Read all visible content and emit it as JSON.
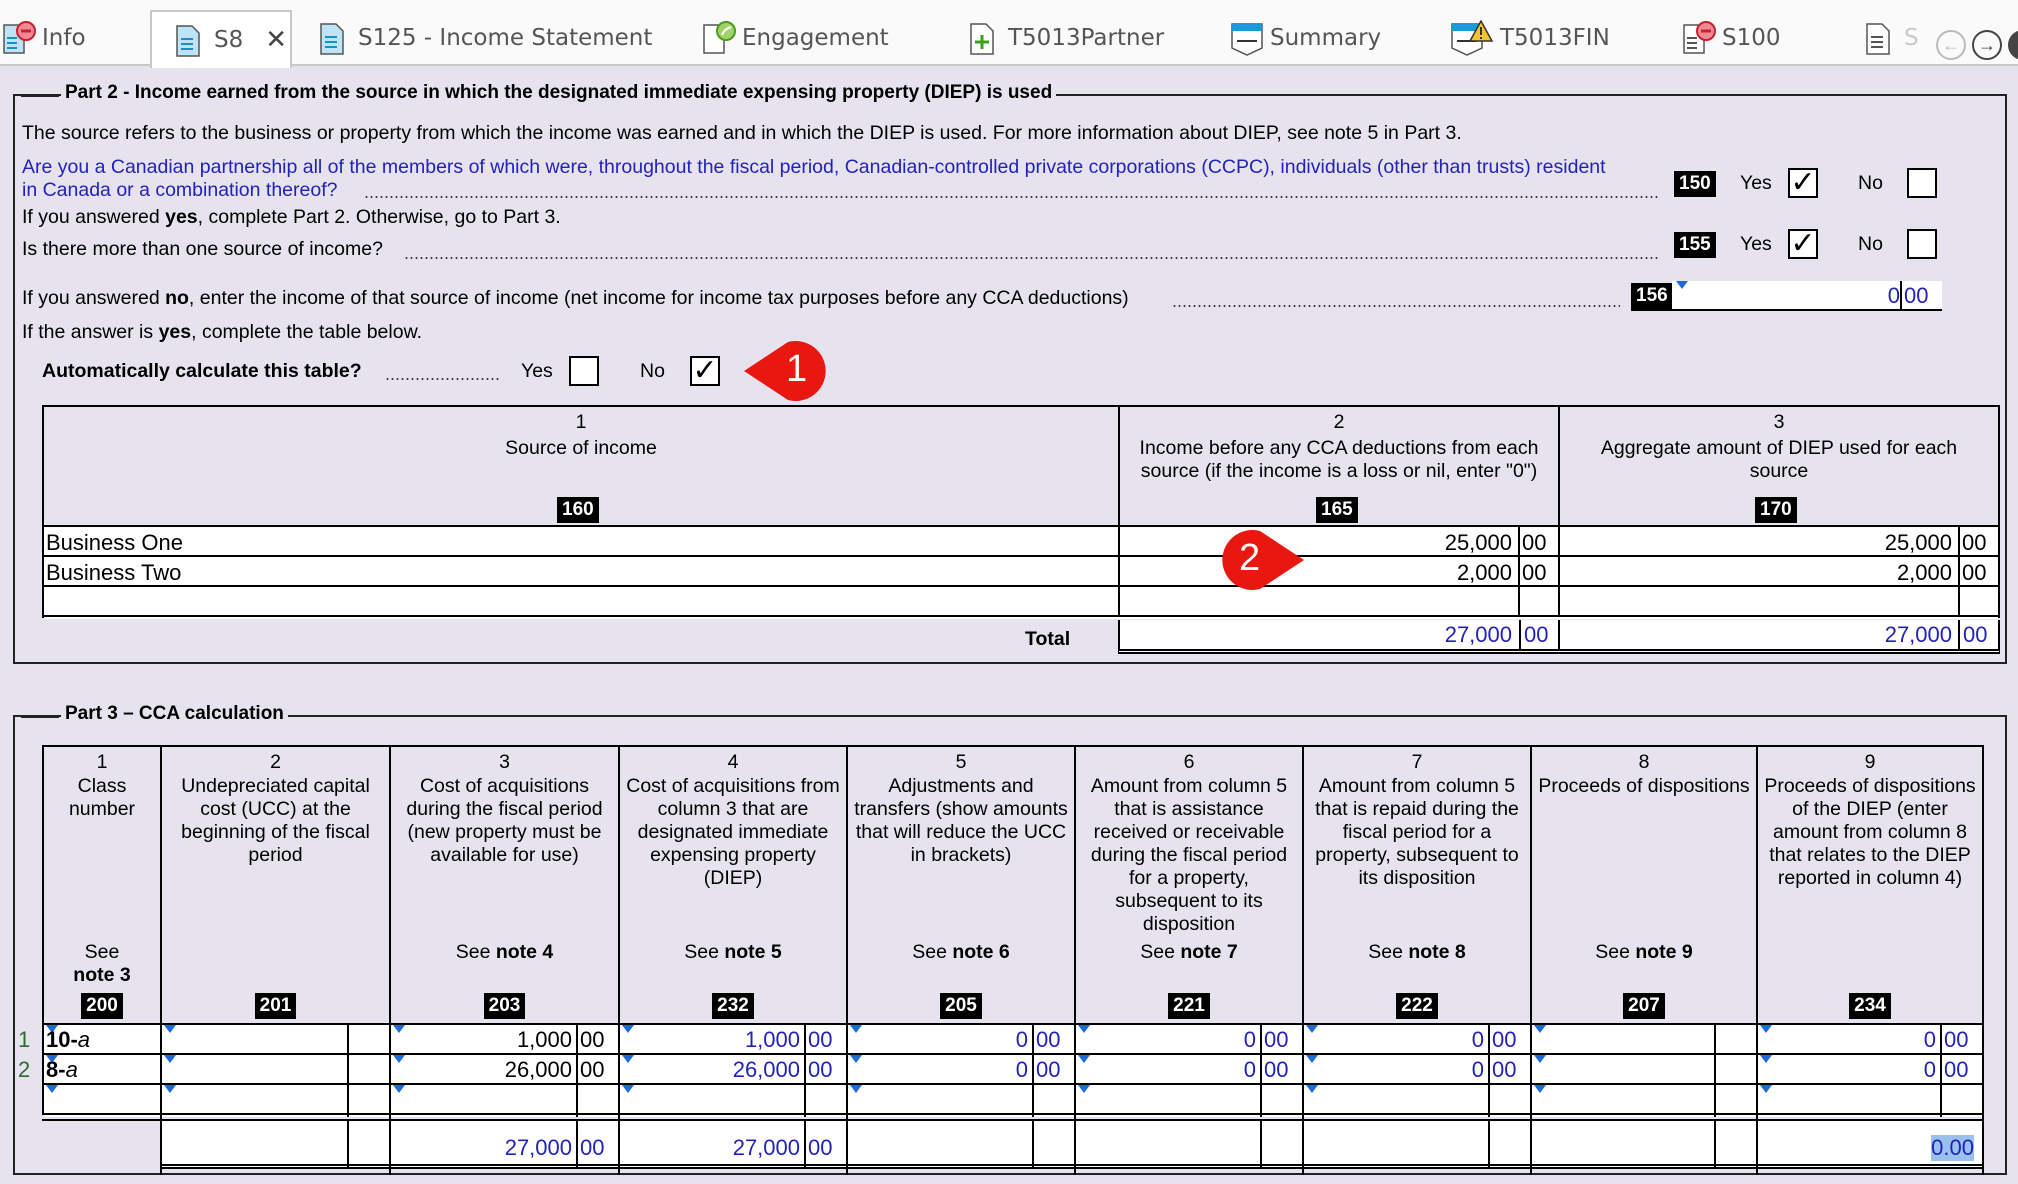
{
  "tabs": [
    {
      "label": "Info",
      "icon": "document-error-icon",
      "active": false
    },
    {
      "label": "S8",
      "icon": "document-icon",
      "active": true,
      "closable": true
    },
    {
      "label": "S125 - Income Statement",
      "icon": "document-icon",
      "active": false
    },
    {
      "label": "Engagement",
      "icon": "document-engagement-icon",
      "active": false
    },
    {
      "label": "T5013Partner",
      "icon": "document-add-icon",
      "active": false
    },
    {
      "label": "Summary",
      "icon": "summary-icon",
      "active": false
    },
    {
      "label": "T5013FIN",
      "icon": "summary-warning-icon",
      "active": false
    },
    {
      "label": "S100",
      "icon": "document-error-icon",
      "active": false
    },
    {
      "label": "S",
      "icon": "document-icon",
      "active": false
    }
  ],
  "part2": {
    "title": "Part 2 - Income earned from the source in which the designated immediate expensing property (DIEP) is used",
    "intro": "The source refers to the business or property from which the income was earned and in which the DIEP is used. For more information about DIEP, see note 5 in Part 3.",
    "q150": {
      "line1": "Are you a Canadian partnership all of the members of which were, throughout the fiscal period, Canadian-controlled private corporations (CCPC), individuals (other than trusts) resident",
      "line2": "in Canada or a combination thereof?",
      "code": "150",
      "yes_label": "Yes",
      "no_label": "No",
      "yes_checked": true,
      "no_checked": false
    },
    "after150_pre": "If you answered ",
    "after150_bold": "yes",
    "after150_post": ", complete Part 2. Otherwise, go to Part 3.",
    "q155": {
      "text": "Is there more than one source of income?",
      "code": "155",
      "yes_label": "Yes",
      "no_label": "No",
      "yes_checked": true,
      "no_checked": false
    },
    "q156": {
      "pre": "If you answered ",
      "bold": "no",
      "post": ", enter the income of that source of income (net income for income tax purposes before any CCA deductions)",
      "code": "156",
      "dollars": "0",
      "cents": "00"
    },
    "ifyes_pre": "If the answer is ",
    "ifyes_bold": "yes",
    "ifyes_post": ", complete the table below.",
    "autocalc": {
      "label": "Automatically calculate this table?",
      "yes_label": "Yes",
      "no_label": "No",
      "yes_checked": false,
      "no_checked": true
    },
    "check_glyph": "✓",
    "table": {
      "columns": [
        {
          "num": "1",
          "title": "Source of income",
          "code": "160"
        },
        {
          "num": "2",
          "title": "Income before any CCA deductions from each source (if the income is a loss or nil, enter \"0\")",
          "code": "165"
        },
        {
          "num": "3",
          "title": "Aggregate amount of DIEP used for each source",
          "code": "170"
        }
      ],
      "rows": [
        {
          "source": "Business One",
          "income": "25,000",
          "income_cents": "00",
          "diep": "25,000",
          "diep_cents": "00"
        },
        {
          "source": "Business Two",
          "income": "2,000",
          "income_cents": "00",
          "diep": "2,000",
          "diep_cents": "00"
        },
        {
          "source": "",
          "income": "",
          "income_cents": "",
          "diep": "",
          "diep_cents": ""
        }
      ],
      "total_label": "Total",
      "total_income": "27,000",
      "total_income_cents": "00",
      "total_diep": "27,000",
      "total_diep_cents": "00"
    }
  },
  "annotations": [
    {
      "label": "1",
      "color": "#e8170f"
    },
    {
      "label": "2",
      "color": "#e8170f"
    }
  ],
  "part3": {
    "title": "Part 3 – CCA calculation",
    "columns": [
      {
        "num": "1",
        "title": "Class number",
        "note_pre": "See",
        "note_bold": "note 3",
        "code": "200"
      },
      {
        "num": "2",
        "title": "Undepreciated capital cost (UCC) at the beginning of the fiscal period",
        "note_pre": "",
        "note_bold": "",
        "code": "201"
      },
      {
        "num": "3",
        "title": "Cost of acquisitions during the fiscal period (new property must be available for use)",
        "note_pre": "See",
        "note_bold": "note 4",
        "code": "203"
      },
      {
        "num": "4",
        "title": "Cost of acquisitions from column 3 that are designated immediate expensing property (DIEP)",
        "note_pre": "See",
        "note_bold": "note 5",
        "code": "232"
      },
      {
        "num": "5",
        "title": "Adjustments and transfers (show amounts that will reduce the UCC in brackets)",
        "note_pre": "See",
        "note_bold": "note 6",
        "code": "205"
      },
      {
        "num": "6",
        "title": "Amount from column 5 that is assistance received or receivable during the fiscal period for a property, subsequent to its disposition",
        "note_pre": "See",
        "note_bold": "note 7",
        "code": "221"
      },
      {
        "num": "7",
        "title": "Amount from column 5 that is repaid during the fiscal period for a property, subsequent to its disposition",
        "note_pre": "See",
        "note_bold": "note 8",
        "code": "222"
      },
      {
        "num": "8",
        "title": "Proceeds of dispositions",
        "note_pre": "See",
        "note_bold": "note 9",
        "code": "207"
      },
      {
        "num": "9",
        "title": "Proceeds of dispositions of the DIEP (enter amount from column 8 that relates to the DIEP reported in column 4)",
        "note_pre": "",
        "note_bold": "",
        "code": "234"
      }
    ],
    "rows": [
      {
        "n": "1",
        "class_bold": "10-",
        "class_ital": "a",
        "c2": "",
        "c2c": "",
        "c3": "1,000",
        "c3c": "00",
        "c4": "1,000",
        "c4c": "00",
        "c5": "0",
        "c5c": "00",
        "c6": "0",
        "c6c": "00",
        "c7": "0",
        "c7c": "00",
        "c8": "",
        "c8c": "",
        "c9": "0",
        "c9c": "00"
      },
      {
        "n": "2",
        "class_bold": "8-",
        "class_ital": "a",
        "c2": "",
        "c2c": "",
        "c3": "26,000",
        "c3c": "00",
        "c4": "26,000",
        "c4c": "00",
        "c5": "0",
        "c5c": "00",
        "c6": "0",
        "c6c": "00",
        "c7": "0",
        "c7c": "00",
        "c8": "",
        "c8c": "",
        "c9": "0",
        "c9c": "00"
      },
      {
        "n": "",
        "class_bold": "",
        "class_ital": "",
        "c2": "",
        "c2c": "",
        "c3": "",
        "c3c": "",
        "c4": "",
        "c4c": "",
        "c5": "",
        "c5c": "",
        "c6": "",
        "c6c": "",
        "c7": "",
        "c7c": "",
        "c8": "",
        "c8c": "",
        "c9": "",
        "c9c": ""
      }
    ],
    "totals": {
      "c3": "27,000",
      "c3c": "00",
      "c4": "27,000",
      "c4c": "00",
      "c9": "0.00"
    }
  }
}
